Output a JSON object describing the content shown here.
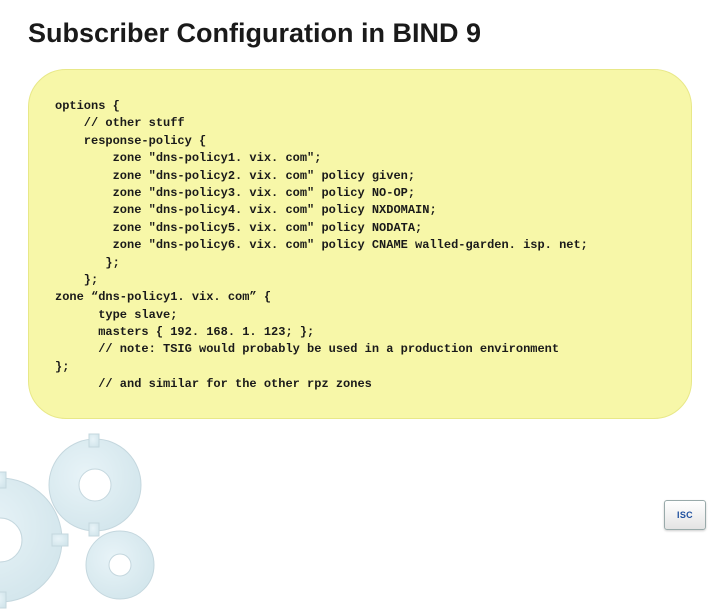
{
  "title": "Subscriber Configuration in BIND 9",
  "code": "options {\n    // other stuff\n    response-policy {\n        zone \"dns-policy1. vix. com\";\n        zone \"dns-policy2. vix. com\" policy given;\n        zone \"dns-policy3. vix. com\" policy NO-OP;\n        zone \"dns-policy4. vix. com\" policy NXDOMAIN;\n        zone \"dns-policy5. vix. com\" policy NODATA;\n        zone \"dns-policy6. vix. com\" policy CNAME walled-garden. isp. net;\n       };\n    };\nzone “dns-policy1. vix. com” {\n      type slave;\n      masters { 192. 168. 1. 123; };\n      // note: TSIG would probably be used in a production environment\n};\n      // and similar for the other rpz zones",
  "logo": "ISC"
}
